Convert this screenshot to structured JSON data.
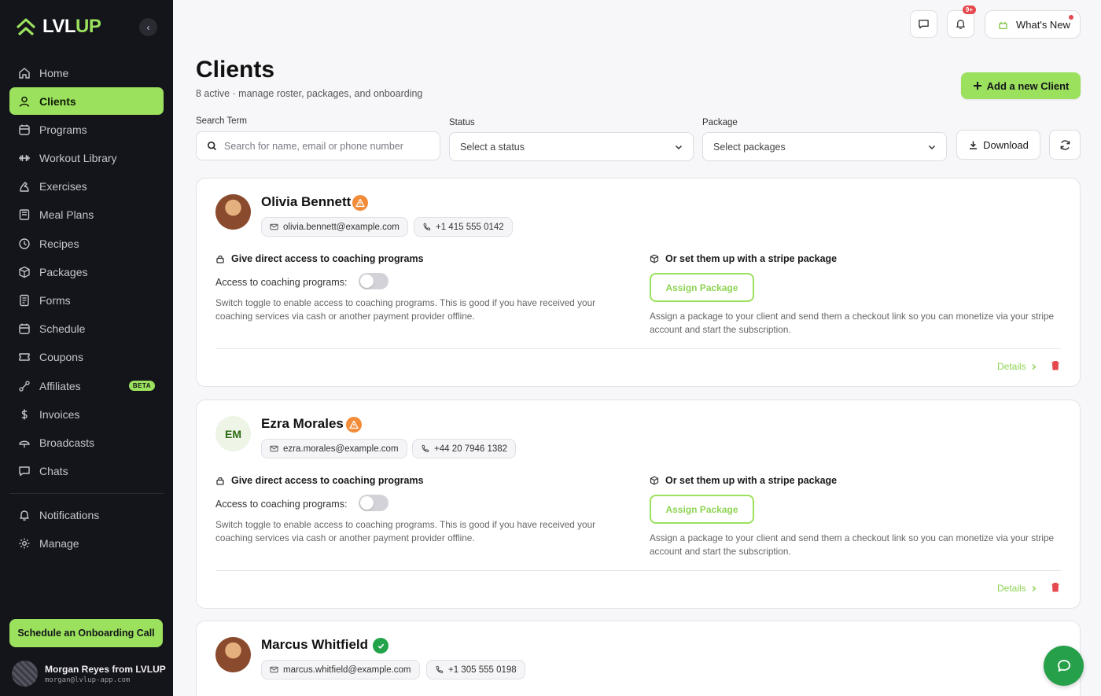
{
  "brand": {
    "name_a": "LVL",
    "name_b": "UP",
    "accent": "#9be15d"
  },
  "sidebar": {
    "items": [
      {
        "label": "Home",
        "icon": "home-icon"
      },
      {
        "label": "Clients",
        "icon": "user-icon",
        "active": true
      },
      {
        "label": "Programs",
        "icon": "calendar-icon"
      },
      {
        "label": "Workout Library",
        "icon": "dumbbell-icon"
      },
      {
        "label": "Exercises",
        "icon": "flex-icon"
      },
      {
        "label": "Meal Plans",
        "icon": "book-icon"
      },
      {
        "label": "Recipes",
        "icon": "clock-icon"
      },
      {
        "label": "Packages",
        "icon": "package-icon"
      },
      {
        "label": "Forms",
        "icon": "form-icon"
      },
      {
        "label": "Schedule",
        "icon": "calendar-icon"
      },
      {
        "label": "Coupons",
        "icon": "coupon-icon"
      },
      {
        "label": "Affiliates",
        "icon": "affiliate-icon",
        "badge": "BETA"
      },
      {
        "label": "Invoices",
        "icon": "dollar-icon"
      },
      {
        "label": "Broadcasts",
        "icon": "broadcast-icon"
      },
      {
        "label": "Chats",
        "icon": "chat-icon"
      }
    ],
    "secondary": [
      {
        "label": "Notifications",
        "icon": "bell-icon"
      },
      {
        "label": "Manage",
        "icon": "gear-icon"
      }
    ],
    "onboard_label": "Schedule an Onboarding Call",
    "user": {
      "name": "Morgan Reyes from LVLUP",
      "email": "morgan@lvlup-app.com"
    }
  },
  "topbar": {
    "notif_badge": "9+",
    "whats_new": "What's New"
  },
  "header": {
    "title": "Clients",
    "subtitle": "8 active · manage roster, packages, and onboarding",
    "add_label": "Add a new Client"
  },
  "filters": {
    "search_label": "Search Term",
    "search_placeholder": "Search for name, email or phone number",
    "status_label": "Status",
    "status_value": "Select a status",
    "package_label": "Package",
    "package_value": "Select packages",
    "download_label": "Download"
  },
  "card_text": {
    "access_heading": "Give direct access to coaching programs",
    "access_label": "Access to coaching programs:",
    "access_desc": "Switch toggle to enable access to coaching programs. This is good if you have received your coaching services via cash or another payment provider offline.",
    "stripe_heading": "Or set them up with a stripe package",
    "assign_label": "Assign Package",
    "stripe_desc": "Assign a package to your client and send them a checkout link so you can monetize via your stripe account and start the subscription.",
    "details_label": "Details"
  },
  "clients": [
    {
      "name": "Olivia Bennett",
      "email": "olivia.bennett@example.com",
      "phone": "+1 415 555 0142",
      "status": "warning",
      "avatar": "photo"
    },
    {
      "name": "Ezra Morales",
      "email": "ezra.morales@example.com",
      "phone": "+44 20 7946 1382",
      "status": "warning",
      "initials": "EM"
    },
    {
      "name": "Marcus Whitfield",
      "email": "marcus.whitfield@example.com",
      "phone": "+1 305 555 0198",
      "status": "verified",
      "avatar": "photo"
    }
  ]
}
